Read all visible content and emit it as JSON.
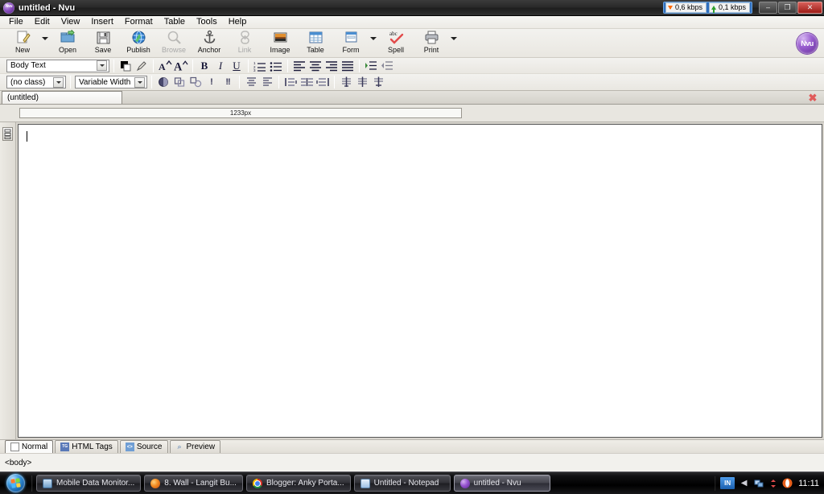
{
  "window": {
    "title": "untitled - Nvu",
    "app_icon": "nvu-logo-icon",
    "minimize_label": "–",
    "maximize_label": "❐",
    "close_label": "✕"
  },
  "netmon": {
    "download": "0,6 kbps",
    "upload": "0,1 kbps",
    "download_icon": "arrow-down-icon",
    "upload_icon": "arrow-up-icon"
  },
  "menubar": {
    "items": [
      "File",
      "Edit",
      "View",
      "Insert",
      "Format",
      "Table",
      "Tools",
      "Help"
    ]
  },
  "toolbar": {
    "buttons": [
      {
        "label": "New",
        "icon": "new-document-icon",
        "disabled": false,
        "dropdown": true
      },
      {
        "label": "Open",
        "icon": "open-folder-icon",
        "disabled": false,
        "dropdown": false
      },
      {
        "label": "Save",
        "icon": "floppy-disk-icon",
        "disabled": false,
        "dropdown": false
      },
      {
        "label": "Publish",
        "icon": "globe-upload-icon",
        "disabled": false,
        "dropdown": false
      },
      {
        "label": "Browse",
        "icon": "magnifier-icon",
        "disabled": true,
        "dropdown": false
      },
      {
        "label": "Anchor",
        "icon": "anchor-icon",
        "disabled": false,
        "dropdown": false
      },
      {
        "label": "Link",
        "icon": "chain-link-icon",
        "disabled": true,
        "dropdown": false
      },
      {
        "label": "Image",
        "icon": "picture-icon",
        "disabled": false,
        "dropdown": false
      },
      {
        "label": "Table",
        "icon": "table-grid-icon",
        "disabled": false,
        "dropdown": false
      },
      {
        "label": "Form",
        "icon": "form-icon",
        "disabled": false,
        "dropdown": true
      },
      {
        "label": "Spell",
        "icon": "spellcheck-abc-icon",
        "disabled": false,
        "dropdown": false
      },
      {
        "label": "Print",
        "icon": "printer-icon",
        "disabled": false,
        "dropdown": true
      }
    ],
    "logo_text": "Nvu"
  },
  "format_bar_1": {
    "paragraph_style": "Body Text",
    "text_color_label": "text-color-swatch",
    "highlight_label": "highlight-color-icon",
    "smaller_text": "A˄",
    "larger_text": "A˄",
    "bold": "B",
    "italic": "I",
    "underline": "U",
    "numbered_list": "numbered-list-icon",
    "bulleted_list": "bulleted-list-icon",
    "align_left": "align-left-icon",
    "align_center": "align-center-icon",
    "align_right": "align-right-icon",
    "align_justify": "align-justify-icon",
    "indent": "indent-icon",
    "outdent": "outdent-icon"
  },
  "format_bar_2": {
    "class_selector": "(no class)",
    "width_selector": "Variable Width",
    "buttons": [
      "table-background-icon",
      "merge-cells-icon",
      "split-cell-icon",
      "single-break-icon",
      "double-break-icon",
      "align-top-icon",
      "align-middle-icon",
      "insert-column-before-icon",
      "insert-column-after-icon",
      "insert-row-icon",
      "delete-column-icon",
      "delete-row-icon",
      "delete-cell-icon"
    ]
  },
  "document_tab": {
    "label": "(untitled)",
    "close_icon": "close-tab-icon",
    "close_glyph": "✖"
  },
  "ruler": {
    "width_label": "1233px"
  },
  "editor": {
    "gutter_icon": "paragraph-marker-icon",
    "content": ""
  },
  "view_tabs": [
    {
      "label": "Normal",
      "icon": "page-icon",
      "active": true,
      "badge": ""
    },
    {
      "label": "HTML Tags",
      "icon": "html-tag-icon",
      "active": false,
      "badge": "TG"
    },
    {
      "label": "Source",
      "icon": "source-code-icon",
      "active": false,
      "badge": "<>"
    },
    {
      "label": "Preview",
      "icon": "preview-eye-icon",
      "active": false,
      "badge": "⌕"
    }
  ],
  "statusbar": {
    "path": "<body>"
  },
  "taskbar": {
    "start_label": "start-orb-icon",
    "items": [
      {
        "label": "Mobile Data Monitor...",
        "icon": "mobile-data-monitor-icon",
        "active": false
      },
      {
        "label": "8. Wall - Langit Bu...",
        "icon": "firefox-icon",
        "active": false
      },
      {
        "label": "Blogger: Anky Porta...",
        "icon": "chrome-icon",
        "active": false
      },
      {
        "label": "Untitled - Notepad",
        "icon": "notepad-icon",
        "active": false
      },
      {
        "label": "untitled - Nvu",
        "icon": "nvu-icon",
        "active": true
      }
    ],
    "tray": {
      "language": "IN",
      "icons": [
        "chevron-left-icon",
        "network-icon",
        "data-transfer-icon",
        "opera-icon"
      ],
      "clock": "11:11"
    }
  }
}
